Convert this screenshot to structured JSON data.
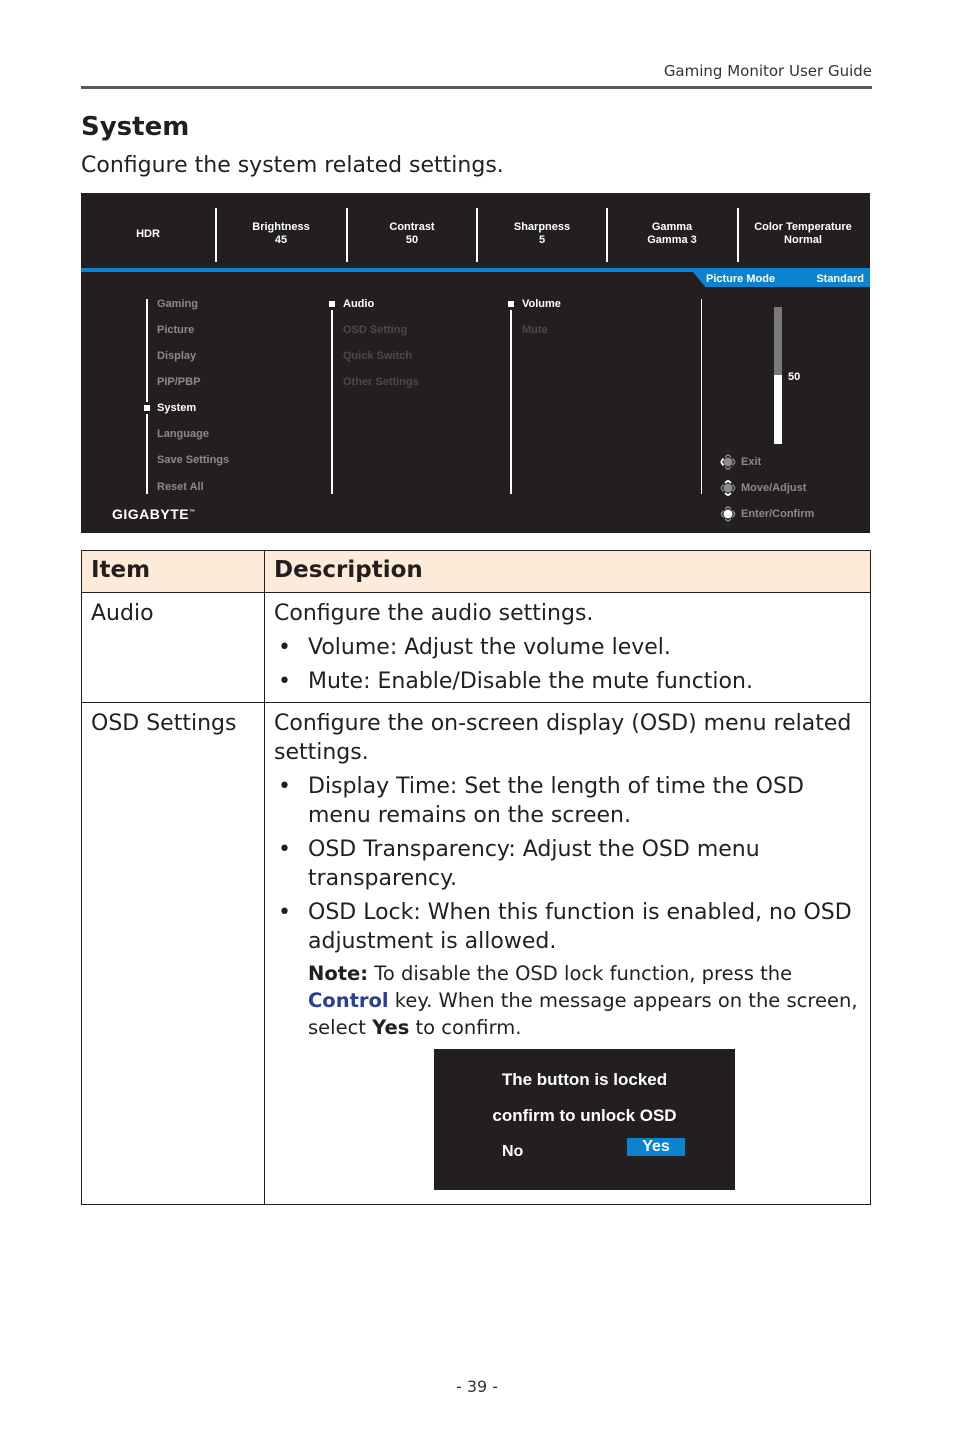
{
  "header": {
    "doc_title": "Gaming Monitor User Guide"
  },
  "section": {
    "title": "System",
    "subtitle": "Configure the system related settings."
  },
  "osd": {
    "top_items": [
      {
        "label": "HDR",
        "value": ""
      },
      {
        "label": "Brightness",
        "value": "45"
      },
      {
        "label": "Contrast",
        "value": "50"
      },
      {
        "label": "Sharpness",
        "value": "5"
      },
      {
        "label": "Gamma",
        "value": "Gamma 3"
      },
      {
        "label": "Color Temperature",
        "value": "Normal"
      }
    ],
    "picture_mode": {
      "label": "Picture Mode",
      "value": "Standard"
    },
    "main_menu": [
      "Gaming",
      "Picture",
      "Display",
      "PIP/PBP",
      "System",
      "Language",
      "Save Settings",
      "Reset All"
    ],
    "main_menu_selected": "System",
    "sub_menu": [
      "Audio",
      "OSD Setting",
      "Quick Switch",
      "Other Settings"
    ],
    "sub_menu_selected": "Audio",
    "sub_sub_menu": [
      "Volume",
      "Mute"
    ],
    "sub_sub_menu_selected": "Volume",
    "slider": {
      "value": "50",
      "fraction": 0.5
    },
    "hints": [
      {
        "icon": "joystick-left-icon",
        "label": "Exit"
      },
      {
        "icon": "joystick-updown-icon",
        "label": "Move/Adjust"
      },
      {
        "icon": "joystick-press-icon",
        "label": "Enter/Confirm"
      }
    ],
    "brand": "GIGABYTE",
    "brand_tm": "™",
    "accent_color": "#0b83cf"
  },
  "table": {
    "headers": [
      "Item",
      "Description"
    ],
    "rows": [
      {
        "item": "Audio",
        "intro": "Configure the audio settings.",
        "bullets": [
          "Volume: Adjust the volume level.",
          "Mute: Enable/Disable the mute function."
        ]
      },
      {
        "item": "OSD Settings",
        "intro": "Configure the on-screen display (OSD) menu related settings.",
        "bullets": [
          "Display Time: Set the length of time the OSD menu remains on the screen.",
          "OSD Transparency: Adjust the OSD menu transparency.",
          "OSD Lock: When this function is enabled, no OSD adjustment is allowed."
        ],
        "note": {
          "label": "Note:",
          "text1": " To disable the OSD lock function, press the ",
          "control": "Control",
          "text2": " key. When the message appears on the screen, select ",
          "yes": "Yes",
          "text3": " to confirm."
        },
        "lock_dialog": {
          "line1": "The button is locked",
          "line2": "confirm to unlock OSD",
          "no": "No",
          "yes": "Yes"
        }
      }
    ]
  },
  "footer": {
    "page_number": "- 39 -"
  }
}
